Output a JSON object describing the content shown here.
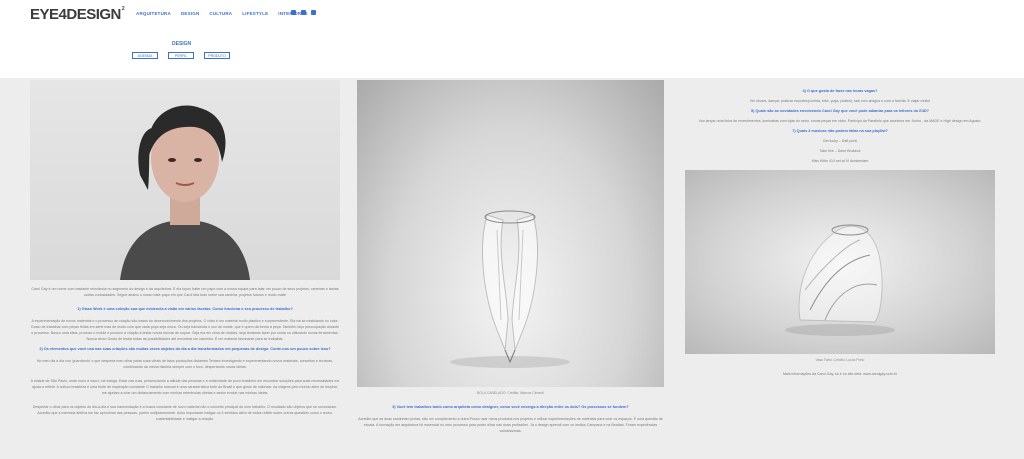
{
  "header": {
    "logo": "EYE4DESIGN",
    "logo_mark": "2",
    "nav": [
      "ARQUITETURA",
      "DESIGN",
      "CULTURA",
      "LIFESTYLE",
      "INTERIORES"
    ],
    "social": [
      "instagram-icon",
      "facebook-icon",
      "linkedin-icon"
    ],
    "accent": "#3c6fd0"
  },
  "banner": {
    "title": "DESIGN",
    "crumbs": [
      "AGENDA",
      "PERFIL",
      "PRODUTO"
    ]
  },
  "col1": {
    "intro": "Carol Gay é um nome com bastante relevância no segmento do design e da arquitetura. E ela topou bater um papo com a nossa equipe para falar um pouco de seus projetos, carreiras e tantas outras curiosidades. Segue abaixo o nosso bate-papo em que Carol fala tudo sobre sua carreira, projetos futuros e muito mais!",
    "q1": "1) Glass Work é uma coleção sua que evidencia a visão em vários facetas. Como funciona o seu processo de trabalho?",
    "a1": "A experimentação de novos materiais e o processo de criação são bases do desenvolvimento dos projetos. O vidro é um material muito plástico e surpreendente. Ela vai se mistuiando no calor. Gosto de trabalhar com peças feitas em série mas de modo com que cada peça seja única. Ou seja transmuta o uso do molde, que é quem dá forma à peça. Também faço preocupação durante o processo. Busco uma ideia, produzo o molde e provoco a criação a testar novas formas de soprar. Seja ela em cima de moldes, seja tentando fazer por conta ou utilizando novas ferramentas. Nunca deixo Gosto de testar todas as possibilidades até encontrar um caminho. É um material fascinante para se trabalhar.",
    "q2": "2) Os elementos que você usa nas suas criações são muitas vezes objetos do dia a dia transformados em pequenas de design. Conte-nos um pouco sobre isso?",
    "a2": "No meu dia a dia vou 'guardando' o que desperta meu olhar pelas suas vitrais de fatos produções distantes Tentam investigando e experimentando novos materiais, conceitos e técnicas, combinando da minha história sempre com o foco, despertando novas ideias.",
    "a3": "A cidade de São Paulo, onde moro é nasci, me instiga. Estar nas ruas, presenciando a atitude das pessoas e a criatividade do povo brasileiro em encontrar soluções para suas necessidades me ajuda a refletir. A cultura brasileira é uma fonte de inspiração constante O trabalho manual é uma característica forte do Brasil e que gosto de valorizar. As viagens pelo mundo além de inspirar, me ajudam a criar um distanciamento com minhas referências diretas e assim evoluir nas minhas ideias.",
    "a4": "Despertar o olhar para os objetos do dia-a-dia e sua transmutação é a busca constante de novo material não o conceito principal do meu trabalho. O resultado são objetos que se comunicam. Acredito que a memória afetiva me faz aproximar das pessoas, porém sutilplacemente. Acho importante instigar os 5 sentidos além de todos refletir sobre outras questões como o reuso, sustentabilidade e instigar a criação."
  },
  "col2": {
    "caption": "BOLA CANELADO. Crédito: Marcos Cimardi",
    "q": "3) Você tem trabalhos tanto como arquiteta como designer, como você enxerga a direção entre os dois? Os processos se fundem?",
    "a": "Acredito que as duas caminham juntas, são um complemento a outra.Posso usar meus produtos nos projetos e utilizar experimentações de materiais para criar os espaços. É uma questão de escala. A formação em arquitetura foi essencial no meu processo para poder olhar nas duas profissões. Já o design aprendi com os irmãos Campana e na Beatlab. Foram experiências valiosíssimas."
  },
  "col3": {
    "q4": "4) O que gosta de fazer nas horas vagas?",
    "a4": "Ver shows, dançar, praticar esportes(corrida, bike, yoga, pilates), sair com amigos e com a família. E viajar muito!",
    "q5": "5) Quais são as novidades envolvendo Carol Gay que você pode adiantar para os leitores do E4D?",
    "a5": "Vou lançar uma linha de revestimentos, luminárias com lojas do setor, novas peças em vidro. Participo da Parallelo que acontece em Junho , da MADE e High design em Agosto.",
    "q7": "7) Quais 3 músicas não podem faltar na sua playlist?",
    "songs": [
      "Get lucky – Daft punk",
      "Take five – Dave Brubeck",
      "Miss Kittin 414 set at IV Amsterdam"
    ],
    "caption": "Vaso Twist. Crédito: Lucas Porto",
    "footer": "Mais informações da Carol Gay, só é no site dela: www.carolgay.com.br"
  }
}
